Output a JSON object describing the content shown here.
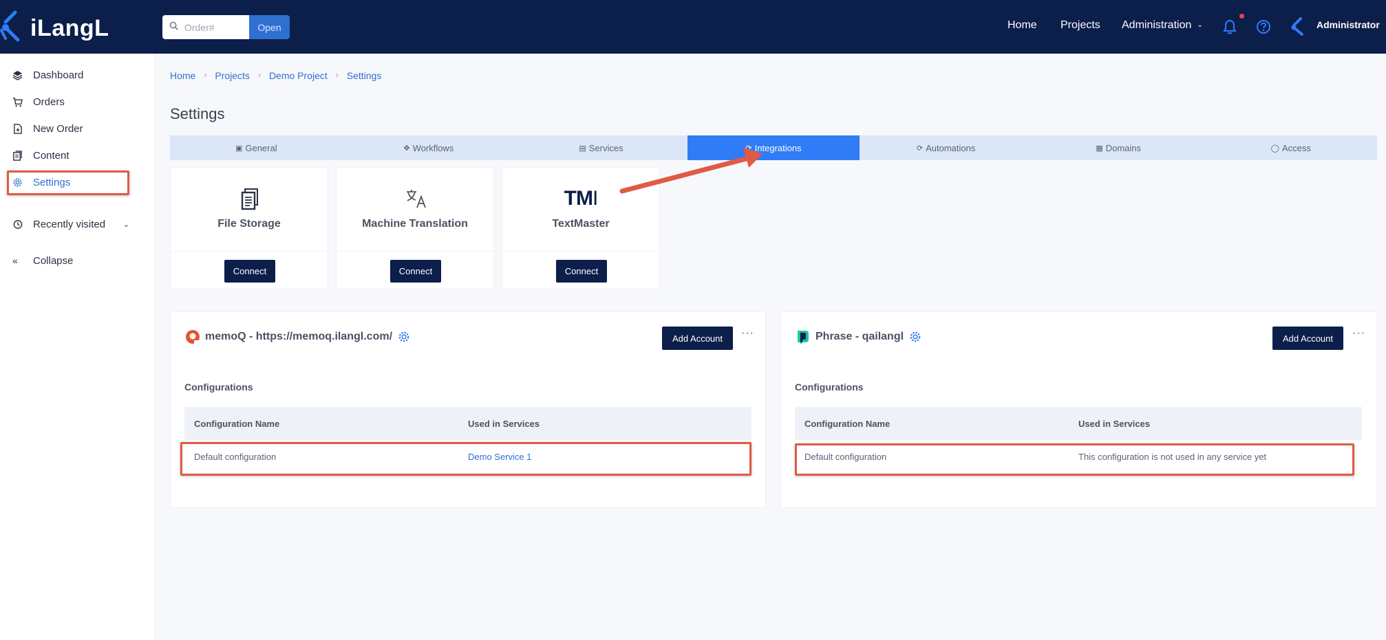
{
  "topbar": {
    "logo_text": "iLangL",
    "search_placeholder": "Order#",
    "open_label": "Open",
    "nav": {
      "home": "Home",
      "projects": "Projects",
      "administration": "Administration"
    },
    "user_name": "Administrator"
  },
  "sidebar": {
    "items": [
      {
        "label": "Dashboard"
      },
      {
        "label": "Orders"
      },
      {
        "label": "New Order"
      },
      {
        "label": "Content"
      },
      {
        "label": "Settings"
      },
      {
        "label": "Recently visited"
      },
      {
        "label": "Collapse"
      }
    ]
  },
  "breadcrumb": [
    "Home",
    "Projects",
    "Demo Project",
    "Settings"
  ],
  "page_title": "Settings",
  "tabs": [
    {
      "label": "General",
      "icon": "monitor-icon"
    },
    {
      "label": "Workflows",
      "icon": "workflow-icon"
    },
    {
      "label": "Services",
      "icon": "server-icon"
    },
    {
      "label": "Integrations",
      "icon": "puzzle-icon",
      "active": true
    },
    {
      "label": "Automations",
      "icon": "refresh-icon"
    },
    {
      "label": "Domains",
      "icon": "building-icon"
    },
    {
      "label": "Access",
      "icon": "shield-icon"
    }
  ],
  "integrations": [
    {
      "name": "File Storage",
      "icon": "file-copy-icon",
      "button": "Connect"
    },
    {
      "name": "Machine Translation",
      "icon": "translate-icon",
      "button": "Connect"
    },
    {
      "name": "TextMaster",
      "icon": "textmaster-logo",
      "logo_text": "TM",
      "button": "Connect"
    }
  ],
  "accounts": [
    {
      "title": "memoQ - https://memoq.ilangl.com/",
      "add_label": "Add Account",
      "more_label": "···",
      "configurations_label": "Configurations",
      "columns": [
        "Configuration Name",
        "Used in Services"
      ],
      "rows": [
        [
          "Default configuration",
          "Demo Service 1"
        ]
      ]
    },
    {
      "title": "Phrase - qailangl",
      "add_label": "Add Account",
      "more_label": "···",
      "configurations_label": "Configurations",
      "columns": [
        "Configuration Name",
        "Used in Services"
      ],
      "rows": [
        [
          "Default configuration",
          "This configuration is not used in any service yet"
        ]
      ]
    }
  ],
  "colors": {
    "topbar": "#0c1e4a",
    "accent": "#2f7cf6",
    "annotation": "#e05a45"
  }
}
